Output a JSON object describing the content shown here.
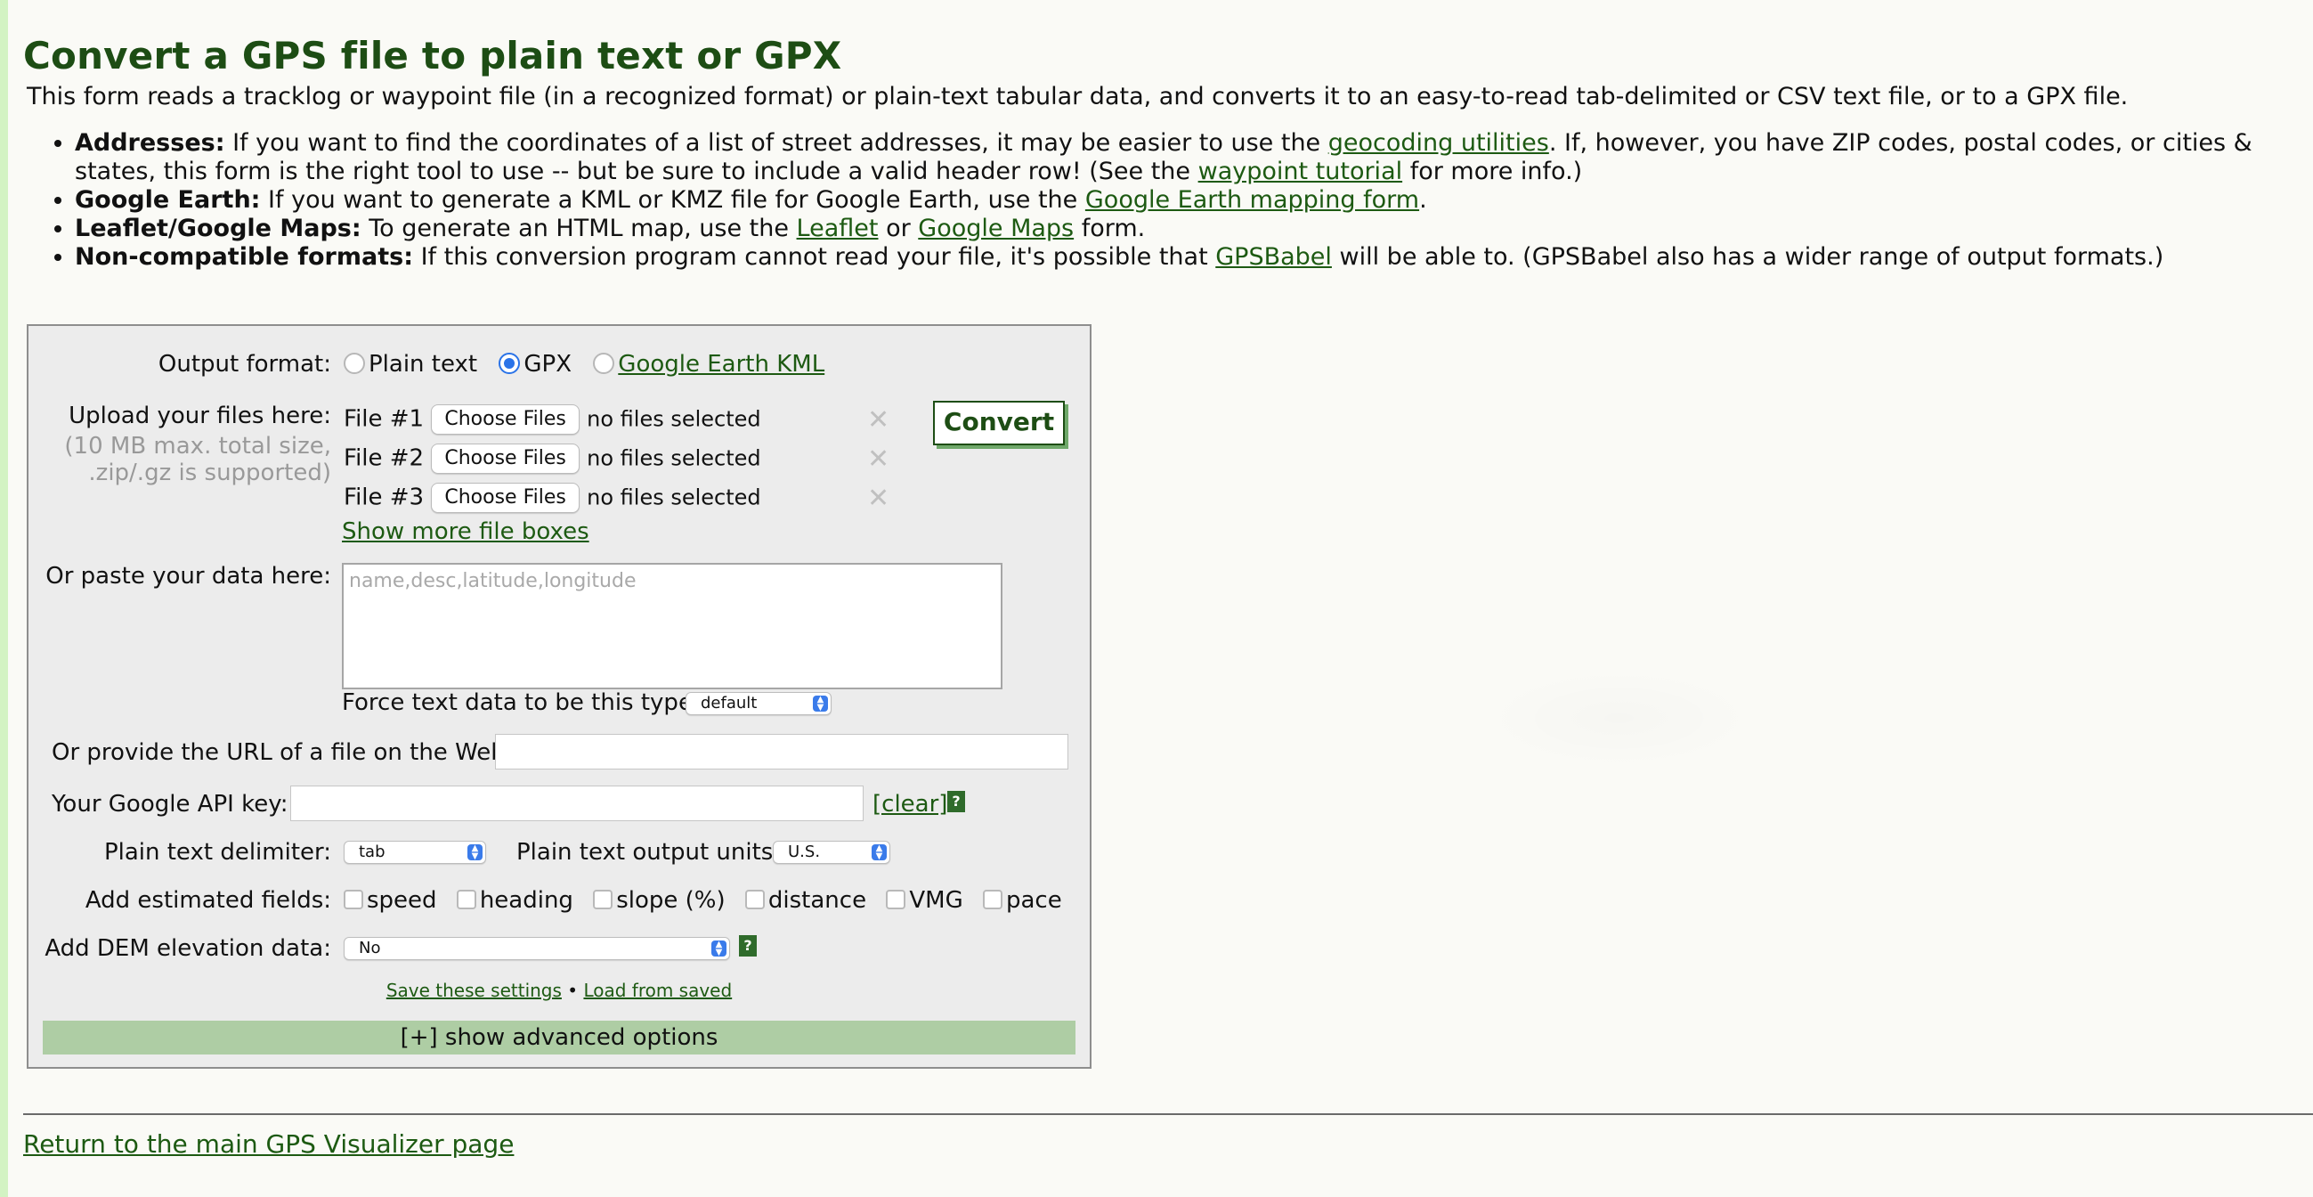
{
  "header": {
    "title": "Convert a GPS file to plain text or GPX",
    "intro": "This form reads a tracklog or waypoint file (in a recognized format) or plain-text tabular data, and converts it to an easy-to-read tab-delimited or CSV text file, or to a GPX file."
  },
  "notes": [
    {
      "label": "Addresses:",
      "t1": " If you want to find the coordinates of a list of street addresses, it may be easier to use the ",
      "link1": "geocoding utilities",
      "t2": ". If, however, you have ZIP codes, postal codes, or cities & states, this form is the right tool to use -- but be sure to include a valid header row! (See the ",
      "link2": "waypoint tutorial",
      "t3": " for more info.)"
    },
    {
      "label": "Google Earth:",
      "t1": " If you want to generate a KML or KMZ file for Google Earth, use the ",
      "link1": "Google Earth mapping form",
      "t2": "."
    },
    {
      "label": "Leaflet/Google Maps:",
      "t1": " To generate an HTML map, use the ",
      "link1": "Leaflet",
      "t2": " or ",
      "link2": "Google Maps",
      "t3": " form."
    },
    {
      "label": "Non-compatible formats:",
      "t1": " If this conversion program cannot read your file, it's possible that ",
      "link1": "GPSBabel",
      "t2": " will be able to. (GPSBabel also has a wider range of output formats.)"
    }
  ],
  "form": {
    "output_format": {
      "label": "Output format:",
      "options": [
        "Plain text",
        "GPX",
        "Google Earth KML"
      ],
      "selected": "GPX"
    },
    "upload": {
      "label": "Upload your files here:",
      "hint1": "(10 MB max. total size,",
      "hint2": ".zip/.gz is supported)",
      "files": [
        {
          "label": "File #1",
          "button": "Choose Files",
          "status": "no files selected"
        },
        {
          "label": "File #2",
          "button": "Choose Files",
          "status": "no files selected"
        },
        {
          "label": "File #3",
          "button": "Choose Files",
          "status": "no files selected"
        }
      ],
      "remove_icon": "✕",
      "more_link": "Show more file boxes",
      "convert_label": "Convert"
    },
    "paste": {
      "label": "Or paste your data here:",
      "placeholder": "name,desc,latitude,longitude",
      "force_label": "Force text data to be this type:",
      "force_value": "default"
    },
    "url": {
      "label": "Or provide the URL of a file on the Web:",
      "value": ""
    },
    "api_key": {
      "label": "Your Google API key:",
      "value": "",
      "clear_link": "[clear]",
      "help_icon": "?"
    },
    "delimiter": {
      "label": "Plain text delimiter:",
      "value": "tab"
    },
    "units": {
      "label": "Plain text output units:",
      "value": "U.S."
    },
    "estimated_fields": {
      "label": "Add estimated fields:",
      "options": [
        "speed",
        "heading",
        "slope (%)",
        "distance",
        "VMG",
        "pace"
      ]
    },
    "dem": {
      "label": "Add DEM elevation data:",
      "value": "No",
      "help_icon": "?"
    },
    "settings": {
      "save": "Save these settings",
      "separator": "•",
      "load": "Load from saved"
    },
    "advanced": "[+] show advanced options"
  },
  "footer": {
    "back_link": "Return to the main GPS Visualizer page"
  },
  "colors": {
    "title": "#1d4d14",
    "link": "#1d5a12",
    "panel_bg": "#ececec",
    "advanced_bar": "#aecda4",
    "left_stripe": "#d3f3c3"
  }
}
